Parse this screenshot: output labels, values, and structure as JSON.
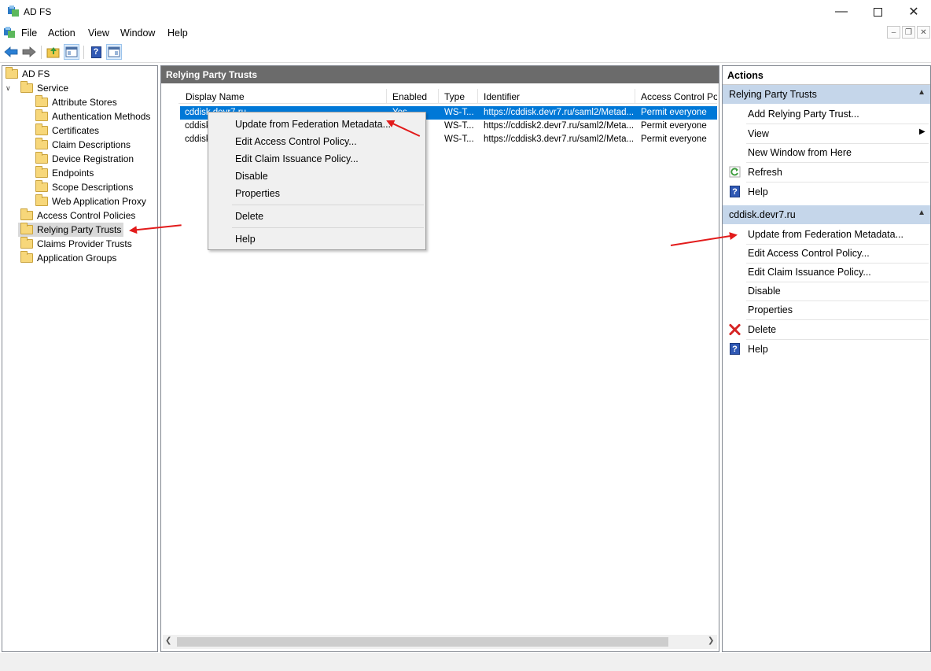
{
  "window": {
    "title": "AD FS"
  },
  "menu": [
    "File",
    "Action",
    "View",
    "Window",
    "Help"
  ],
  "tree": {
    "root": "AD FS",
    "service": "Service",
    "service_children": [
      "Attribute Stores",
      "Authentication Methods",
      "Certificates",
      "Claim Descriptions",
      "Device Registration",
      "Endpoints",
      "Scope Descriptions",
      "Web Application Proxy"
    ],
    "top_items": [
      "Access Control Policies",
      "Relying Party Trusts",
      "Claims Provider Trusts",
      "Application Groups"
    ],
    "selected": "Relying Party Trusts"
  },
  "center": {
    "header": "Relying Party Trusts",
    "columns": [
      "Display Name",
      "Enabled",
      "Type",
      "Identifier",
      "Access Control Polic"
    ],
    "rows": [
      {
        "name": "cddisk.devr7.ru",
        "enabled": "Yes",
        "type": "WS-T...",
        "identifier": "https://cddisk.devr7.ru/saml2/Metad...",
        "policy": "Permit everyone"
      },
      {
        "name": "cddisk",
        "enabled": "",
        "type": "WS-T...",
        "identifier": "https://cddisk2.devr7.ru/saml2/Meta...",
        "policy": "Permit everyone"
      },
      {
        "name": "cddisk",
        "enabled": "",
        "type": "WS-T...",
        "identifier": "https://cddisk3.devr7.ru/saml2/Meta...",
        "policy": "Permit everyone"
      }
    ]
  },
  "context_menu": {
    "items": [
      "Update from Federation Metadata...",
      "Edit Access Control Policy...",
      "Edit Claim Issuance Policy...",
      "Disable",
      "Properties",
      "Delete",
      "Help"
    ]
  },
  "actions": {
    "title": "Actions",
    "section1": {
      "label": "Relying Party Trusts",
      "items": [
        "Add Relying Party Trust...",
        "View",
        "New Window from Here",
        "Refresh",
        "Help"
      ]
    },
    "section2": {
      "label": "cddisk.devr7.ru",
      "items": [
        "Update from Federation Metadata...",
        "Edit Access Control Policy...",
        "Edit Claim Issuance Policy...",
        "Disable",
        "Properties",
        "Delete",
        "Help"
      ]
    }
  },
  "colors": {
    "selection": "#0078d7",
    "section_bg": "#c5d6ea",
    "header_bg": "#6b6b6b",
    "annotation": "#e21b1b"
  },
  "icons": [
    "adfs-app-icon",
    "back-arrow-icon",
    "forward-arrow-icon",
    "up-folder-icon",
    "show-hide-tree-icon",
    "help-icon",
    "show-hide-actions-icon",
    "refresh-icon",
    "delete-x-icon",
    "folder-icon"
  ]
}
